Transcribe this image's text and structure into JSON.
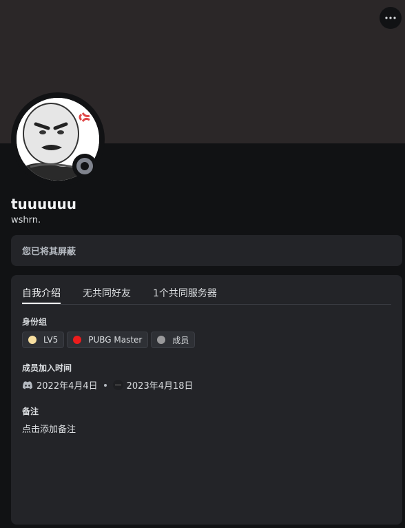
{
  "banner": {
    "color": "#2b2728"
  },
  "more_button": {
    "icon": "more-horizontal-icon"
  },
  "profile": {
    "display_name": "tuuuuuu",
    "username": "wshrn.",
    "status": "offline",
    "avatar_icon": "meme-avatar"
  },
  "blocked_notice": "您已将其屏蔽",
  "tabs": [
    {
      "label": "自我介绍",
      "active": true
    },
    {
      "label": "无共同好友",
      "active": false
    },
    {
      "label": "1个共同服务器",
      "active": false
    }
  ],
  "roles_section": {
    "title": "身份组",
    "roles": [
      {
        "name": "LV5",
        "color": "#f7dfa0"
      },
      {
        "name": "PUBG Master",
        "color": "#ed1c1c"
      },
      {
        "name": "成员",
        "color": "#99999b"
      }
    ]
  },
  "member_since": {
    "title": "成员加入时间",
    "discord_date": "2022年4月4日",
    "server_date": "2023年4月18日",
    "discord_icon": "discord-icon",
    "server_icon": "server-icon"
  },
  "note_section": {
    "title": "备注",
    "placeholder": "点击添加备注"
  }
}
